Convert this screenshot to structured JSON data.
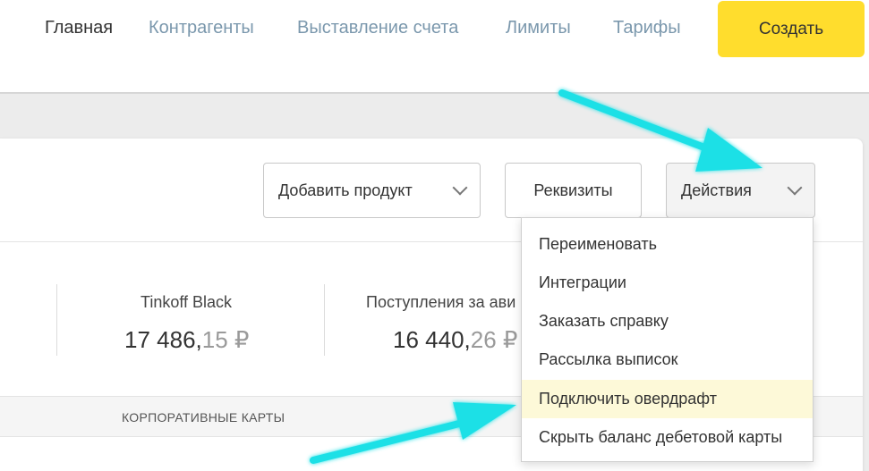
{
  "nav": {
    "items": [
      {
        "label": "Главная",
        "active": true
      },
      {
        "label": "Контрагенты",
        "active": false
      },
      {
        "label": "Выставление счета",
        "active": false
      },
      {
        "label": "Лимиты",
        "active": false
      },
      {
        "label": "Тарифы",
        "active": false
      }
    ],
    "create_label": "Создать"
  },
  "toolbar": {
    "add_product_label": "Добавить продукт",
    "requisites_label": "Реквизиты",
    "actions_label": "Действия"
  },
  "balances": [
    {
      "label": "Tinkoff Black",
      "int": "17 486,",
      "frac": "15 ₽"
    },
    {
      "label": "Поступления за ави",
      "int": "16 440,",
      "frac": "26 ₽"
    }
  ],
  "cards_section_label": "КОРПОРАТИВНЫЕ КАРТЫ",
  "actions_menu": {
    "items": [
      {
        "label": "Переименовать",
        "highlighted": false
      },
      {
        "label": "Интеграции",
        "highlighted": false
      },
      {
        "label": "Заказать справку",
        "highlighted": false
      },
      {
        "label": "Рассылка выписок",
        "highlighted": false
      },
      {
        "label": "Подключить овердрафт",
        "highlighted": true
      },
      {
        "label": "Скрыть баланс дебетовой карты",
        "highlighted": false
      }
    ]
  },
  "colors": {
    "accent": "#ffdd2d",
    "nav_link": "#7b98ad",
    "highlight": "#fdf9d8",
    "annotation_arrow": "#1fe0e6"
  }
}
